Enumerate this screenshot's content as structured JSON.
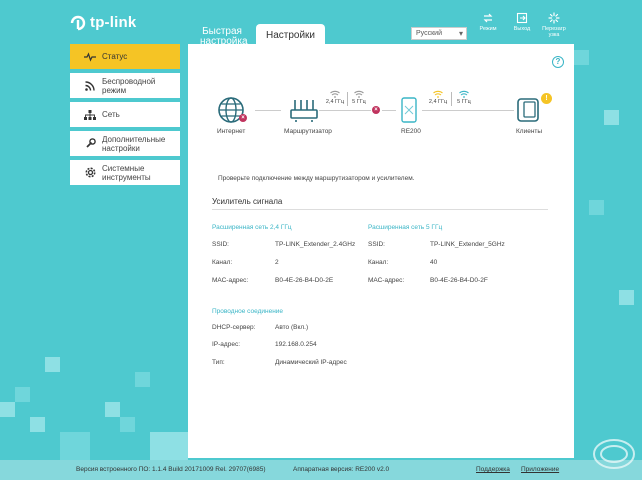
{
  "brand": {
    "name": "tp-link"
  },
  "tabs": [
    {
      "label": "Быстрая настройка"
    },
    {
      "label": "Настройки"
    }
  ],
  "language": {
    "selected": "Русский"
  },
  "top_actions": [
    {
      "label": "Режим",
      "icon": "mode-icon"
    },
    {
      "label": "Выход",
      "icon": "logout-icon"
    },
    {
      "label": "Перезагрузка",
      "icon": "reboot-icon"
    }
  ],
  "sidebar": {
    "items": [
      {
        "label": "Статус",
        "icon": "status-icon",
        "active": true
      },
      {
        "label": "Беспроводной режим",
        "icon": "wireless-icon"
      },
      {
        "label": "Сеть",
        "icon": "network-icon"
      },
      {
        "label": "Дополнительные настройки",
        "icon": "advanced-icon"
      },
      {
        "label": "Системные инструменты",
        "icon": "tools-icon"
      }
    ]
  },
  "topology": {
    "internet": "Интернет",
    "router": "Маршрутизатор",
    "extender": "RE200",
    "clients": "Клиенты",
    "band_24": "2,4 ГГц",
    "band_5": "5 ГГц",
    "error_mark": "×",
    "notice_mark": "!"
  },
  "hint": "Проверьте подключение между маршрутизатором и усилителем.",
  "extender_section": {
    "title": "Усилитель сигнала",
    "net24": {
      "title": "Расширенная сеть 2,4 ГГц",
      "ssid_label": "SSID:",
      "ssid": "TP-LINK_Extender_2.4GHz",
      "channel_label": "Канал:",
      "channel": "2",
      "mac_label": "МАС-адрес:",
      "mac": "B0-4E-26-B4-D0-2E"
    },
    "net5": {
      "title": "Расширенная сеть 5 ГГц",
      "ssid_label": "SSID:",
      "ssid": "TP-LINK_Extender_5GHz",
      "channel_label": "Канал:",
      "channel": "40",
      "mac_label": "МАС-адрес:",
      "mac": "B0-4E-26-B4-D0-2F"
    },
    "wired": {
      "title": "Проводное соединение",
      "dhcp_label": "DHCP-сервер:",
      "dhcp": "Авто (Вкл.)",
      "ip_label": "IP-адрес:",
      "ip": "192.168.0.254",
      "type_label": "Тип:",
      "type": "Динамический IP-адрес"
    }
  },
  "footer": {
    "firmware": "Версия встроенного ПО: 1.1.4 Build 20171009 Rel. 29707(6985)",
    "hardware": "Аппаратная версия: RE200 v2.0",
    "support": "Поддержка",
    "app": "Приложение"
  },
  "colors": {
    "background": "#4ec9cf",
    "accent": "#3ab5c6",
    "active": "#f5c425",
    "error": "#c0335e"
  }
}
